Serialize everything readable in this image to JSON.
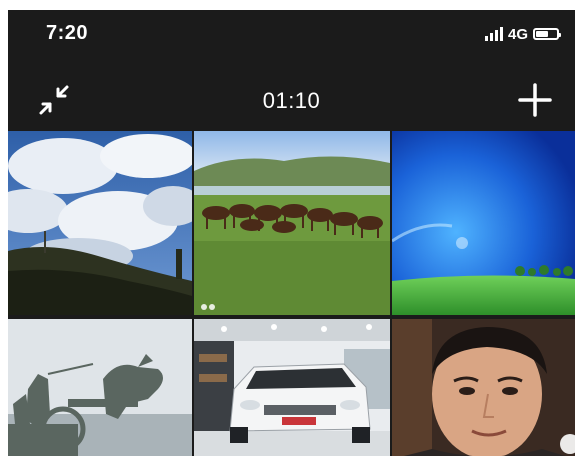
{
  "status_bar": {
    "time": "7:20",
    "network": "4G",
    "signal_bars": 4,
    "battery_level": 0.55
  },
  "toolbar": {
    "timer": "01:10",
    "collapse_icon": "collapse-arrows-icon",
    "add_icon": "plus-icon"
  },
  "gallery": {
    "photos": [
      {
        "subject": "cloudy-sky-hill"
      },
      {
        "subject": "horses-grassland"
      },
      {
        "subject": "blue-sky-wallpaper"
      },
      {
        "subject": "chariot-statue"
      },
      {
        "subject": "white-suv-showroom"
      },
      {
        "subject": "man-portrait"
      }
    ]
  },
  "colors": {
    "background": "#1b1b1b",
    "text": "#ffffff"
  }
}
